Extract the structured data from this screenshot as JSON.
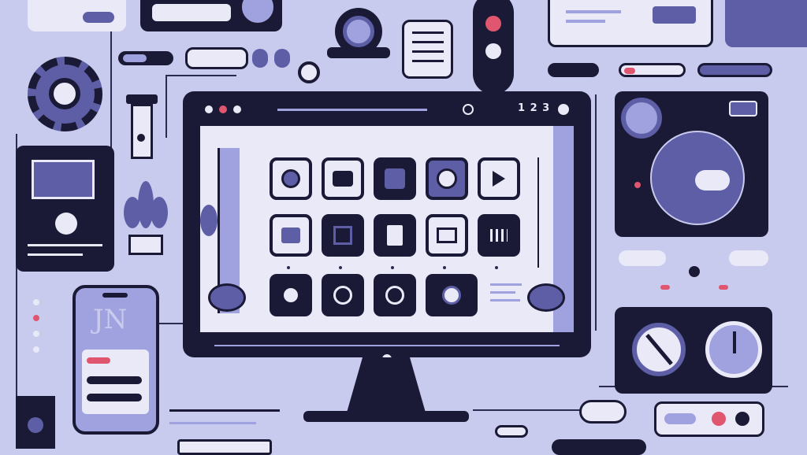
{
  "monitor": {
    "counter_text": "1 2 3",
    "icons_row1": [
      "record-icon",
      "camera-icon",
      "photo-icon",
      "lens-icon",
      "play-icon"
    ],
    "icons_row2": [
      "face-icon",
      "frame-icon",
      "document-icon",
      "screen-icon",
      "grid-icon"
    ],
    "icons_row3": [
      "circle-icon",
      "shield-icon",
      "mail-icon",
      "time-icon"
    ]
  },
  "phone": {
    "script_text": "JN"
  },
  "colors": {
    "background": "#c9cbee",
    "dark": "#1b1a36",
    "mid": "#5d5ea6",
    "light": "#e9e9f8",
    "accent": "#e0566f"
  }
}
